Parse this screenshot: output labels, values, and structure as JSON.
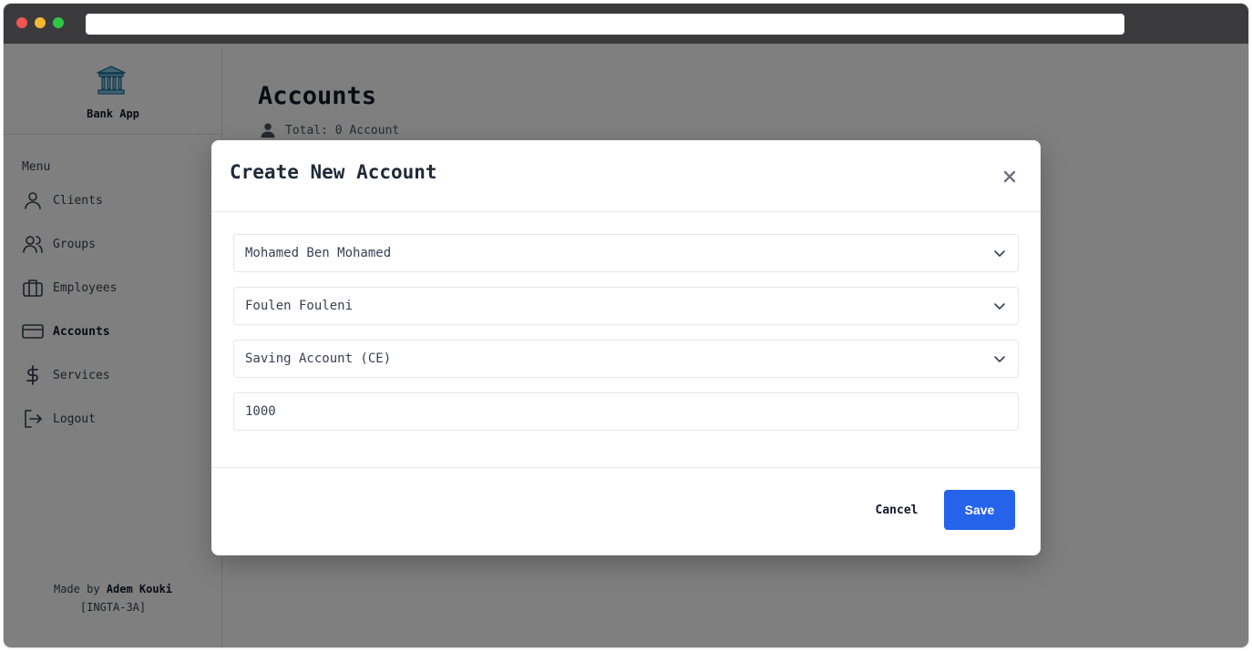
{
  "app": {
    "brand_name": "Bank App",
    "brand_icon": "bank-icon"
  },
  "sidebar": {
    "menu_title": "Menu",
    "items": [
      {
        "label": "Clients",
        "icon": "user-icon"
      },
      {
        "label": "Groups",
        "icon": "users-icon"
      },
      {
        "label": "Employees",
        "icon": "briefcase-icon"
      },
      {
        "label": "Accounts",
        "icon": "credit-card-icon",
        "active": true
      },
      {
        "label": "Services",
        "icon": "dollar-icon"
      },
      {
        "label": "Logout",
        "icon": "logout-icon"
      }
    ],
    "footer_prefix": "Made by",
    "footer_author": "Adem Kouki",
    "footer_class": "[INGTA-3A]"
  },
  "main": {
    "title": "Accounts",
    "total_text": "Total: 0 Account"
  },
  "modal": {
    "title": "Create New Account",
    "client_select": "Mohamed Ben Mohamed",
    "employee_select": "Foulen Fouleni",
    "account_type_select": "Saving Account (CE)",
    "balance_input": "1000",
    "cancel_label": "Cancel",
    "save_label": "Save"
  },
  "colors": {
    "accent": "#2563eb",
    "brand_icon": "#3b82f6",
    "overlay": "rgba(0,0,0,0.5)"
  }
}
